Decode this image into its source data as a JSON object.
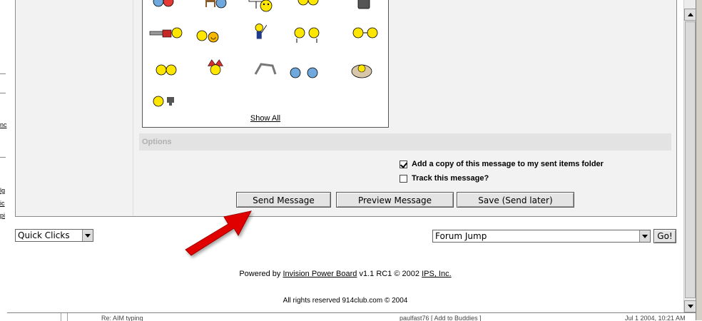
{
  "smilies_panel": {
    "show_all_label": "Show All"
  },
  "options": {
    "section_label": "Options",
    "sent_copy_label": "Add a copy of this message to my sent items folder",
    "sent_copy_checked": true,
    "track_label": "Track this message?",
    "track_checked": false
  },
  "buttons": {
    "send": "Send Message",
    "preview": "Preview Message",
    "save": "Save (Send later)"
  },
  "quick_clicks": {
    "selected": "Quick Clicks"
  },
  "forum_jump": {
    "selected": "Forum Jump",
    "go_label": "Go!"
  },
  "footer": {
    "powered_by": "Powered by",
    "ipb_link": "Invision Power Board",
    "version": "v1.1 RC1 © 2002",
    "ips_link": "IPS, Inc.",
    "rights": "All rights reserved 914club.com © 2004"
  },
  "background_window": {
    "left_fragments": [
      "nc",
      "lg",
      "ic",
      "pi"
    ],
    "bottom_fragments": [
      "Re: AIM typing",
      "paulfast76 [ Add to Buddies ]",
      "Jul 1 2004, 10:21 AM"
    ]
  },
  "colors": {
    "panel_bg": "#f2f2f2",
    "options_bar": "#e3e3e3",
    "annotation_arrow": "#e00000"
  }
}
